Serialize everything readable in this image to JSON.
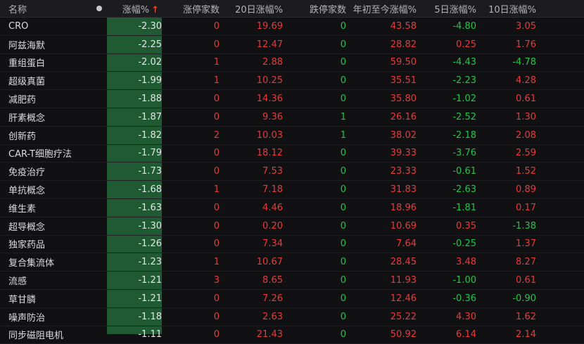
{
  "header": {
    "name": "名称",
    "change_pct": "涨幅%",
    "sort_icon": "arrow-up-icon",
    "limit_up": "涨停家数",
    "d20_change": "20日涨幅%",
    "limit_down": "跌停家数",
    "ytd_change": "年初至今涨幅%",
    "d5_change": "5日涨幅%",
    "d10_change": "10日涨幅%"
  },
  "colors": {
    "up": "#e83a3a",
    "down": "#27c24c",
    "highlight_column": "#1f5a32",
    "background": "#111114"
  },
  "rows": [
    {
      "name": "CRO",
      "change_pct": "-2.30",
      "limit_up": "0",
      "d20_change": "19.69",
      "limit_down": "0",
      "ytd_change": "43.58",
      "d5_change": "-4.80",
      "d10_change": "3.05"
    },
    {
      "name": "阿兹海默",
      "change_pct": "-2.25",
      "limit_up": "0",
      "d20_change": "12.47",
      "limit_down": "0",
      "ytd_change": "28.82",
      "d5_change": "0.25",
      "d10_change": "1.76"
    },
    {
      "name": "重组蛋白",
      "change_pct": "-2.02",
      "limit_up": "1",
      "d20_change": "2.88",
      "limit_down": "0",
      "ytd_change": "59.50",
      "d5_change": "-4.43",
      "d10_change": "-4.78"
    },
    {
      "name": "超级真菌",
      "change_pct": "-1.99",
      "limit_up": "1",
      "d20_change": "10.25",
      "limit_down": "0",
      "ytd_change": "35.51",
      "d5_change": "-2.23",
      "d10_change": "4.28"
    },
    {
      "name": "减肥药",
      "change_pct": "-1.88",
      "limit_up": "0",
      "d20_change": "14.36",
      "limit_down": "0",
      "ytd_change": "35.80",
      "d5_change": "-1.02",
      "d10_change": "0.61"
    },
    {
      "name": "肝素概念",
      "change_pct": "-1.87",
      "limit_up": "0",
      "d20_change": "9.36",
      "limit_down": "1",
      "ytd_change": "26.16",
      "d5_change": "-2.52",
      "d10_change": "1.30"
    },
    {
      "name": "创新药",
      "change_pct": "-1.82",
      "limit_up": "2",
      "d20_change": "10.03",
      "limit_down": "1",
      "ytd_change": "38.02",
      "d5_change": "-2.18",
      "d10_change": "2.08"
    },
    {
      "name": "CAR-T细胞疗法",
      "change_pct": "-1.79",
      "limit_up": "0",
      "d20_change": "18.12",
      "limit_down": "0",
      "ytd_change": "39.33",
      "d5_change": "-3.76",
      "d10_change": "2.59"
    },
    {
      "name": "免疫治疗",
      "change_pct": "-1.73",
      "limit_up": "0",
      "d20_change": "7.53",
      "limit_down": "0",
      "ytd_change": "23.33",
      "d5_change": "-0.61",
      "d10_change": "1.52"
    },
    {
      "name": "单抗概念",
      "change_pct": "-1.68",
      "limit_up": "1",
      "d20_change": "7.18",
      "limit_down": "0",
      "ytd_change": "31.83",
      "d5_change": "-2.63",
      "d10_change": "0.89"
    },
    {
      "name": "维生素",
      "change_pct": "-1.63",
      "limit_up": "0",
      "d20_change": "4.46",
      "limit_down": "0",
      "ytd_change": "18.96",
      "d5_change": "-1.81",
      "d10_change": "0.17"
    },
    {
      "name": "超导概念",
      "change_pct": "-1.30",
      "limit_up": "0",
      "d20_change": "0.20",
      "limit_down": "0",
      "ytd_change": "10.69",
      "d5_change": "0.35",
      "d10_change": "-1.38"
    },
    {
      "name": "独家药品",
      "change_pct": "-1.26",
      "limit_up": "0",
      "d20_change": "7.34",
      "limit_down": "0",
      "ytd_change": "7.64",
      "d5_change": "-0.25",
      "d10_change": "1.37"
    },
    {
      "name": "复合集流体",
      "change_pct": "-1.23",
      "limit_up": "1",
      "d20_change": "10.67",
      "limit_down": "0",
      "ytd_change": "28.45",
      "d5_change": "3.48",
      "d10_change": "8.27"
    },
    {
      "name": "流感",
      "change_pct": "-1.21",
      "limit_up": "3",
      "d20_change": "8.65",
      "limit_down": "0",
      "ytd_change": "11.93",
      "d5_change": "-1.00",
      "d10_change": "0.61"
    },
    {
      "name": "草甘膦",
      "change_pct": "-1.21",
      "limit_up": "0",
      "d20_change": "7.26",
      "limit_down": "0",
      "ytd_change": "12.46",
      "d5_change": "-0.36",
      "d10_change": "-0.90"
    },
    {
      "name": "噪声防治",
      "change_pct": "-1.18",
      "limit_up": "0",
      "d20_change": "2.63",
      "limit_down": "0",
      "ytd_change": "25.22",
      "d5_change": "4.30",
      "d10_change": "1.62"
    },
    {
      "name": "同步磁阻电机",
      "change_pct": "-1.11",
      "limit_up": "0",
      "d20_change": "21.43",
      "limit_down": "0",
      "ytd_change": "50.92",
      "d5_change": "6.14",
      "d10_change": "2.14"
    }
  ]
}
